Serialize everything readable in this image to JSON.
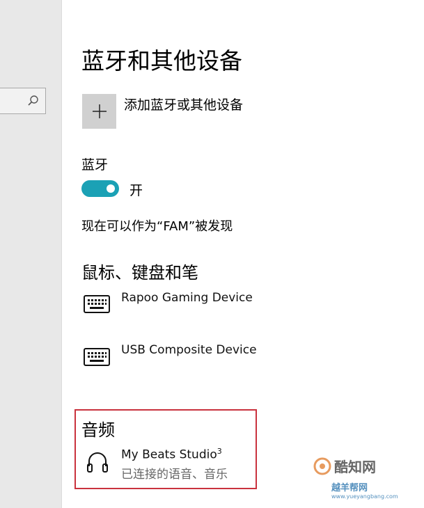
{
  "sidebar": {
    "search": {
      "placeholder": ""
    }
  },
  "page": {
    "title": "蓝牙和其他设备"
  },
  "add_device": {
    "label": "添加蓝牙或其他设备"
  },
  "bluetooth": {
    "label": "蓝牙",
    "state": "开",
    "discoverable_text": "现在可以作为“FAM”被发现",
    "toggle_color": "#1ba1b5"
  },
  "mouse_keyboard_pen": {
    "title": "鼠标、键盘和笔",
    "devices": [
      {
        "name": "Rapoo Gaming Device",
        "icon": "keyboard-icon"
      },
      {
        "name": "USB Composite Device",
        "icon": "keyboard-icon"
      }
    ]
  },
  "audio": {
    "title": "音频",
    "devices": [
      {
        "name": "My Beats Studio",
        "superscript": "3",
        "status": "已连接的语音、音乐",
        "icon": "headphones-icon"
      }
    ],
    "highlight_color": "#c9323d"
  },
  "watermarks": {
    "primary": "酷知网",
    "secondary_title": "越羊帮网",
    "secondary_url": "www.yueyangbang.com"
  }
}
